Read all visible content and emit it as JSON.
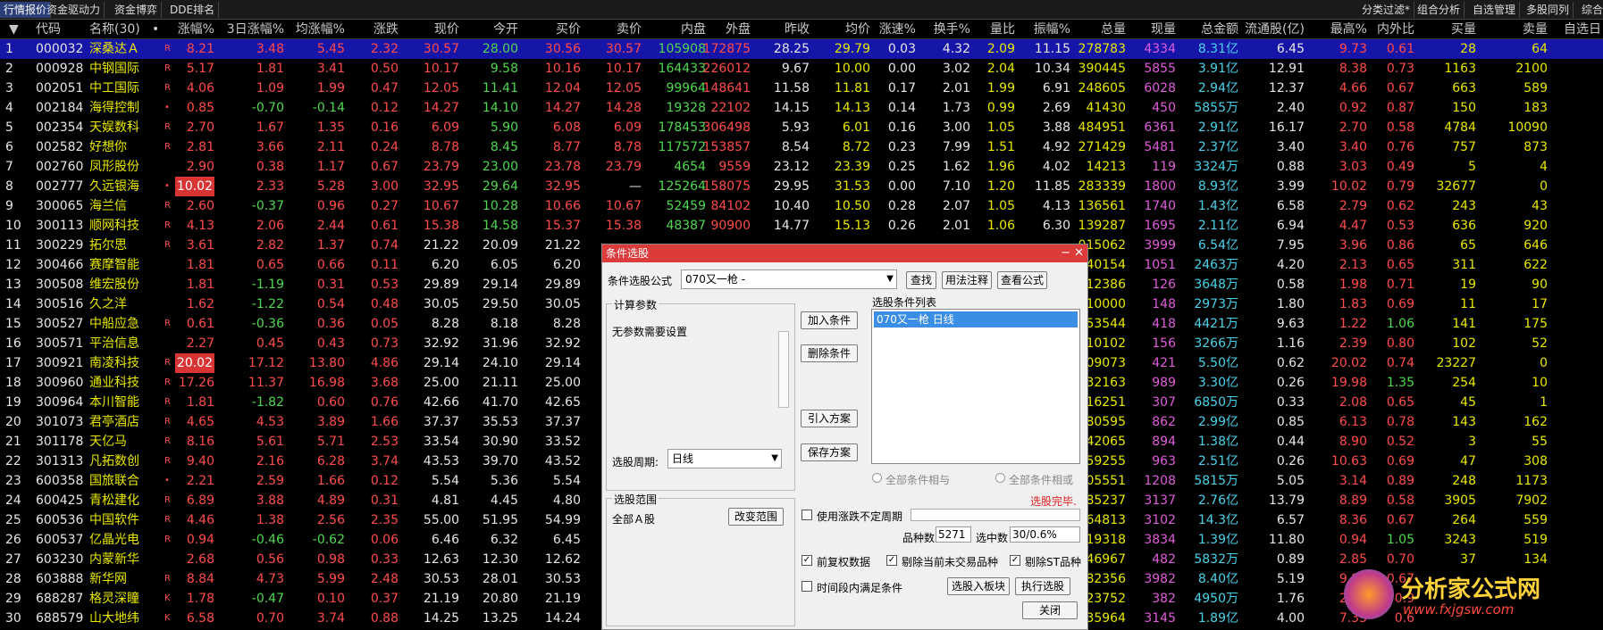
{
  "topbar": {
    "left": [
      "行情报价",
      "资金驱动力",
      "资金博弈",
      "DDE排名"
    ],
    "right": [
      "分类过滤*",
      "组合分析",
      "自选管理",
      "多股同列",
      "综合排"
    ]
  },
  "headers": [
    "代码",
    "名称(30)",
    "•",
    "涨幅%",
    "3日涨幅%",
    "均涨幅%",
    "涨跌",
    "现价",
    "今开",
    "买价",
    "卖价",
    "内盘",
    "外盘",
    "昨收",
    "均价",
    "涨速%",
    "换手%",
    "量比",
    "振幅%",
    "总量",
    "现量",
    "总金额",
    "流通股(亿)",
    "最高%",
    "内外比",
    "买量",
    "卖量",
    "自选日"
  ],
  "rows": [
    {
      "n": "1",
      "code": "000032",
      "name": "深桑达Ａ",
      "m": "R",
      "v": [
        "8.21",
        "3.48",
        "5.45",
        "2.32",
        "30.57",
        "28.00",
        "30.56",
        "30.57",
        "105908",
        "172875",
        "28.25",
        "29.79",
        "0.03",
        "4.32",
        "2.09",
        "11.15",
        "278783",
        "4334",
        "8.31亿",
        "6.45",
        "9.73",
        "0.61",
        "28",
        "64"
      ]
    },
    {
      "n": "2",
      "code": "000928",
      "name": "中钢国际",
      "m": "R",
      "v": [
        "5.17",
        "1.81",
        "3.41",
        "0.50",
        "10.17",
        "9.58",
        "10.16",
        "10.17",
        "164433",
        "226012",
        "9.67",
        "10.00",
        "0.00",
        "3.02",
        "2.04",
        "10.34",
        "390445",
        "5855",
        "3.91亿",
        "12.91",
        "8.38",
        "0.73",
        "1163",
        "2100"
      ]
    },
    {
      "n": "3",
      "code": "002051",
      "name": "中工国际",
      "m": "R",
      "v": [
        "4.06",
        "1.09",
        "1.99",
        "0.47",
        "12.05",
        "11.41",
        "12.04",
        "12.05",
        "99964",
        "148641",
        "11.58",
        "11.81",
        "0.17",
        "2.01",
        "1.99",
        "6.91",
        "248605",
        "6028",
        "2.94亿",
        "12.37",
        "4.66",
        "0.67",
        "663",
        "589"
      ]
    },
    {
      "n": "4",
      "code": "002184",
      "name": "海得控制",
      "m": "•",
      "v": [
        "0.85",
        "-0.70",
        "-0.14",
        "0.12",
        "14.27",
        "14.10",
        "14.27",
        "14.28",
        "19328",
        "22102",
        "14.15",
        "14.13",
        "0.14",
        "1.73",
        "0.99",
        "2.69",
        "41430",
        "450",
        "5855万",
        "2.40",
        "0.92",
        "0.87",
        "150",
        "183"
      ]
    },
    {
      "n": "5",
      "code": "002354",
      "name": "天娱数科",
      "m": "R",
      "v": [
        "2.70",
        "1.67",
        "1.35",
        "0.16",
        "6.09",
        "5.90",
        "6.08",
        "6.09",
        "178453",
        "306498",
        "5.93",
        "6.01",
        "0.16",
        "3.00",
        "1.05",
        "3.88",
        "484951",
        "6361",
        "2.91亿",
        "16.17",
        "2.70",
        "0.58",
        "4784",
        "10090"
      ]
    },
    {
      "n": "6",
      "code": "002582",
      "name": "好想你",
      "m": "R",
      "v": [
        "2.81",
        "3.66",
        "2.11",
        "0.24",
        "8.78",
        "8.45",
        "8.77",
        "8.78",
        "117572",
        "153857",
        "8.54",
        "8.72",
        "0.23",
        "7.99",
        "1.51",
        "4.92",
        "271429",
        "5481",
        "2.37亿",
        "3.40",
        "3.40",
        "0.76",
        "757",
        "873"
      ]
    },
    {
      "n": "7",
      "code": "002760",
      "name": "凤形股份",
      "m": "",
      "v": [
        "2.90",
        "0.38",
        "1.17",
        "0.67",
        "23.79",
        "23.00",
        "23.78",
        "23.79",
        "4654",
        "9559",
        "23.12",
        "23.39",
        "0.25",
        "1.62",
        "1.96",
        "4.02",
        "14213",
        "119",
        "3324万",
        "0.88",
        "3.03",
        "0.49",
        "5",
        "4"
      ]
    },
    {
      "n": "8",
      "code": "002777",
      "name": "久远银海",
      "m": "•",
      "v": [
        "10.02",
        "2.33",
        "5.28",
        "3.00",
        "32.95",
        "29.64",
        "32.95",
        "—",
        "125264",
        "158075",
        "29.95",
        "31.53",
        "0.00",
        "7.10",
        "1.20",
        "11.85",
        "283339",
        "1800",
        "8.93亿",
        "3.99",
        "10.02",
        "0.79",
        "32677",
        "0"
      ],
      "lim": true
    },
    {
      "n": "9",
      "code": "300065",
      "name": "海兰信",
      "m": "R",
      "v": [
        "2.60",
        "-0.37",
        "0.96",
        "0.27",
        "10.67",
        "10.28",
        "10.66",
        "10.67",
        "52459",
        "84102",
        "10.40",
        "10.50",
        "0.28",
        "2.07",
        "1.05",
        "4.13",
        "136561",
        "1740",
        "1.43亿",
        "6.58",
        "2.79",
        "0.62",
        "243",
        "43"
      ]
    },
    {
      "n": "10",
      "code": "300113",
      "name": "顺网科技",
      "m": "R",
      "v": [
        "4.13",
        "2.06",
        "2.44",
        "0.61",
        "15.38",
        "14.58",
        "15.37",
        "15.38",
        "48387",
        "90900",
        "14.77",
        "15.13",
        "0.26",
        "2.01",
        "1.06",
        "6.30",
        "139287",
        "1695",
        "2.11亿",
        "6.94",
        "4.47",
        "0.53",
        "636",
        "920"
      ]
    },
    {
      "n": "11",
      "code": "300229",
      "name": "拓尔思",
      "m": "R",
      "v": [
        "3.61",
        "2.82",
        "1.37",
        "0.74",
        "21.22",
        "20.09",
        "21.22",
        "",
        "",
        "",
        "",
        "",
        "",
        "",
        "",
        "",
        "015062",
        "3999",
        "6.54亿",
        "7.95",
        "3.96",
        "0.86",
        "65",
        "646"
      ]
    },
    {
      "n": "12",
      "code": "300466",
      "name": "赛摩智能",
      "m": "",
      "v": [
        "1.81",
        "0.65",
        "0.66",
        "0.11",
        "6.20",
        "6.05",
        "6.20",
        "",
        "",
        "",
        "",
        "",
        "",
        "",
        "",
        "",
        "40154",
        "1051",
        "2463万",
        "4.20",
        "2.13",
        "0.65",
        "311",
        "622"
      ]
    },
    {
      "n": "13",
      "code": "300508",
      "name": "维宏股份",
      "m": "",
      "v": [
        "1.81",
        "-1.19",
        "0.31",
        "0.53",
        "29.89",
        "29.14",
        "29.89",
        "",
        "",
        "",
        "",
        "",
        "",
        "",
        "",
        "",
        "12386",
        "126",
        "3648万",
        "0.58",
        "1.98",
        "0.71",
        "19",
        "90"
      ]
    },
    {
      "n": "14",
      "code": "300516",
      "name": "久之洋",
      "m": "",
      "v": [
        "1.62",
        "-1.22",
        "0.54",
        "0.48",
        "30.05",
        "29.50",
        "30.05",
        "",
        "",
        "",
        "",
        "",
        "",
        "",
        "",
        "",
        "10000",
        "148",
        "2973万",
        "1.80",
        "1.83",
        "0.69",
        "11",
        "17"
      ]
    },
    {
      "n": "15",
      "code": "300527",
      "name": "中船应急",
      "m": "R",
      "v": [
        "0.61",
        "-0.36",
        "0.36",
        "0.05",
        "8.28",
        "8.18",
        "8.28",
        "",
        "",
        "",
        "",
        "",
        "",
        "",
        "",
        "",
        "53544",
        "418",
        "4421万",
        "9.63",
        "1.22",
        "1.06",
        "141",
        "175"
      ]
    },
    {
      "n": "16",
      "code": "300571",
      "name": "平治信息",
      "m": "",
      "v": [
        "2.27",
        "0.45",
        "0.43",
        "0.73",
        "32.92",
        "31.96",
        "32.92",
        "",
        "",
        "",
        "",
        "",
        "",
        "",
        "",
        "",
        "10102",
        "156",
        "3266万",
        "1.16",
        "2.39",
        "0.80",
        "102",
        "52"
      ]
    },
    {
      "n": "17",
      "code": "300921",
      "name": "南凌科技",
      "m": "R",
      "v": [
        "20.02",
        "17.12",
        "13.80",
        "4.86",
        "29.14",
        "24.10",
        "29.14",
        "",
        "",
        "",
        "",
        "",
        "",
        "",
        "",
        "",
        "09073",
        "421",
        "5.50亿",
        "0.62",
        "20.02",
        "0.74",
        "23227",
        "0"
      ],
      "lim": true
    },
    {
      "n": "18",
      "code": "300960",
      "name": "通业科技",
      "m": "R",
      "v": [
        "17.26",
        "11.37",
        "16.98",
        "3.68",
        "25.00",
        "21.11",
        "25.00",
        "",
        "",
        "",
        "",
        "",
        "",
        "",
        "",
        "",
        "32163",
        "989",
        "3.30亿",
        "0.26",
        "19.98",
        "1.35",
        "254",
        "10"
      ]
    },
    {
      "n": "19",
      "code": "300964",
      "name": "本川智能",
      "m": "R",
      "v": [
        "1.81",
        "-1.82",
        "0.60",
        "0.76",
        "42.66",
        "41.70",
        "42.65",
        "",
        "",
        "",
        "",
        "",
        "",
        "",
        "",
        "",
        "16251",
        "307",
        "6850万",
        "0.33",
        "2.08",
        "0.65",
        "45",
        "1"
      ]
    },
    {
      "n": "20",
      "code": "301073",
      "name": "君亭酒店",
      "m": "R",
      "v": [
        "4.65",
        "4.53",
        "3.89",
        "1.66",
        "37.37",
        "35.53",
        "37.37",
        "",
        "",
        "",
        "",
        "",
        "",
        "",
        "",
        "",
        "80595",
        "862",
        "2.99亿",
        "0.85",
        "6.13",
        "0.78",
        "143",
        "162"
      ]
    },
    {
      "n": "21",
      "code": "301178",
      "name": "天亿马",
      "m": "R",
      "v": [
        "8.16",
        "5.61",
        "5.71",
        "2.53",
        "33.54",
        "30.90",
        "33.52",
        "",
        "",
        "",
        "",
        "",
        "",
        "",
        "",
        "",
        "42065",
        "894",
        "1.38亿",
        "0.44",
        "8.90",
        "0.52",
        "3",
        "55"
      ]
    },
    {
      "n": "22",
      "code": "301313",
      "name": "凡拓数创",
      "m": "R",
      "v": [
        "9.40",
        "2.16",
        "6.28",
        "3.74",
        "43.53",
        "39.70",
        "43.52",
        "",
        "",
        "",
        "",
        "",
        "",
        "",
        "",
        "",
        "59255",
        "963",
        "2.51亿",
        "0.26",
        "10.63",
        "0.69",
        "47",
        "308"
      ]
    },
    {
      "n": "23",
      "code": "600358",
      "name": "国旅联合",
      "m": "•",
      "v": [
        "2.21",
        "2.59",
        "1.66",
        "0.12",
        "5.54",
        "5.36",
        "5.54",
        "",
        "",
        "",
        "",
        "",
        "",
        "",
        "",
        "",
        "05551",
        "1208",
        "5815万",
        "5.05",
        "3.14",
        "0.89",
        "248",
        "1173"
      ]
    },
    {
      "n": "24",
      "code": "600425",
      "name": "青松建化",
      "m": "R",
      "v": [
        "6.89",
        "3.88",
        "4.89",
        "0.31",
        "4.81",
        "4.45",
        "4.80",
        "",
        "",
        "",
        "",
        "",
        "",
        "",
        "",
        "",
        "85237",
        "3137",
        "2.76亿",
        "13.79",
        "8.89",
        "0.58",
        "3905",
        "7902"
      ]
    },
    {
      "n": "25",
      "code": "600536",
      "name": "中国软件",
      "m": "R",
      "v": [
        "4.46",
        "1.38",
        "2.56",
        "2.35",
        "55.00",
        "51.95",
        "54.99",
        "",
        "",
        "",
        "",
        "",
        "",
        "",
        "",
        "",
        "64813",
        "3102",
        "14.3亿",
        "6.57",
        "8.36",
        "0.67",
        "264",
        "559"
      ]
    },
    {
      "n": "26",
      "code": "600537",
      "name": "亿晶光电",
      "m": "R",
      "v": [
        "0.94",
        "-0.46",
        "-0.62",
        "0.06",
        "6.46",
        "6.32",
        "6.45",
        "",
        "",
        "",
        "",
        "",
        "",
        "",
        "",
        "",
        "19318",
        "3834",
        "1.39亿",
        "11.80",
        "0.94",
        "1.05",
        "3243",
        "519"
      ]
    },
    {
      "n": "27",
      "code": "603230",
      "name": "内蒙新华",
      "m": "",
      "v": [
        "2.68",
        "0.56",
        "0.98",
        "0.33",
        "12.63",
        "12.30",
        "12.62",
        "",
        "",
        "",
        "",
        "",
        "",
        "",
        "",
        "",
        "46967",
        "482",
        "5832万",
        "0.89",
        "2.85",
        "0.70",
        "37",
        "134"
      ]
    },
    {
      "n": "28",
      "code": "603888",
      "name": "新华网",
      "m": "R",
      "v": [
        "8.84",
        "4.73",
        "5.99",
        "2.48",
        "30.53",
        "28.01",
        "30.53",
        "",
        "",
        "",
        "",
        "",
        "",
        "",
        "",
        "",
        "82356",
        "3982",
        "8.40亿",
        "5.19",
        "9.91",
        "0.67",
        "",
        ""
      ]
    },
    {
      "n": "29",
      "code": "688287",
      "name": "格灵深瞳",
      "m": "K",
      "v": [
        "1.78",
        "-0.47",
        "0.10",
        "0.37",
        "21.19",
        "20.80",
        "21.19",
        "",
        "",
        "",
        "",
        "",
        "",
        "",
        "",
        "",
        "23752",
        "382",
        "4950万",
        "1.76",
        "2.21",
        "0.9",
        "",
        ""
      ]
    },
    {
      "n": "30",
      "code": "688579",
      "name": "山大地纬",
      "m": "K",
      "v": [
        "6.58",
        "0.70",
        "3.74",
        "0.88",
        "14.25",
        "13.25",
        "14.24",
        "",
        "",
        "",
        "",
        "",
        "",
        "",
        "",
        "",
        "35964",
        "3145",
        "1.89亿",
        "4.00",
        "7.33",
        "0.6",
        "",
        ""
      ]
    }
  ],
  "dialog": {
    "title": "条件选股",
    "formula_label": "条件选股公式",
    "formula_value": "070又一枪  -",
    "btn_find": "查找",
    "btn_usage": "用法注释",
    "btn_view": "查看公式",
    "params_title": "计算参数",
    "params_text": "无参数需要设置",
    "period_label": "选股周期:",
    "period_value": "日线",
    "btn_add": "加入条件",
    "btn_delete": "删除条件",
    "btn_import": "引入方案",
    "btn_save": "保存方案",
    "list_title": "选股条件列表",
    "list_item": "070又一枪  日线",
    "radio_and": "全部条件相与",
    "radio_or": "全部条件相或",
    "status": "选股完毕.",
    "range_title": "选股范围",
    "range_value": "全部Ａ股",
    "btn_change": "改变范围",
    "chk_uncertain": "使用涨跌不定周期",
    "count_label": "品种数",
    "count_value": "5271",
    "selected_label": "选中数",
    "selected_value": "30/0.6%",
    "chk_adjust": "前复权数据",
    "chk_notrade": "剔除当前未交易品种",
    "chk_st": "剔除ST品种",
    "chk_period": "时间段内满足条件",
    "btn_toblock": "选股入板块",
    "btn_exec": "执行选股",
    "btn_close": "关闭"
  },
  "watermark": {
    "text": "分析家公式网",
    "url": "www.fxjgsw.com"
  },
  "colors": {
    "up": "#ff4b4b",
    "down": "#4fd84f",
    "selected_row": "#1515a8",
    "dialog_title": "#dc3b3b"
  }
}
